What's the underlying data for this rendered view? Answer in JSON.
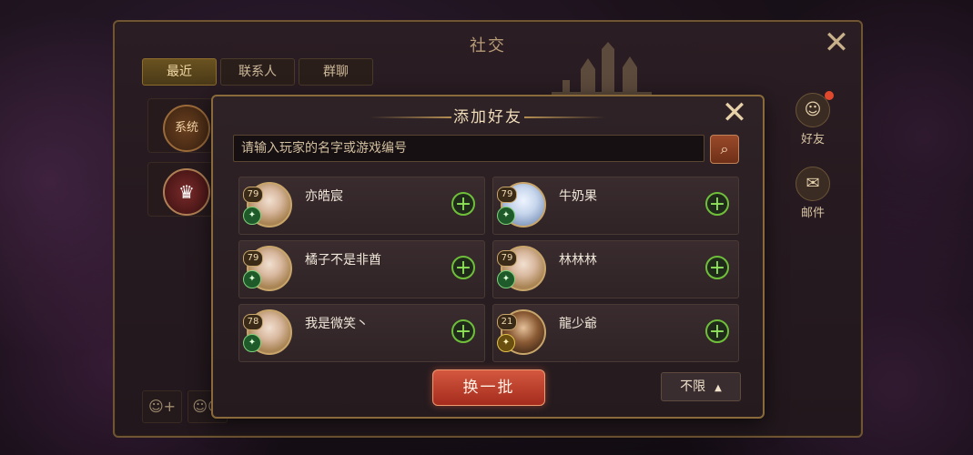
{
  "social_panel": {
    "title": "社交",
    "tabs": [
      {
        "label": "最近",
        "active": true
      },
      {
        "label": "联系人",
        "active": false
      },
      {
        "label": "群聊",
        "active": false
      }
    ],
    "recent": [
      {
        "label": "系统"
      }
    ],
    "side_nav": [
      {
        "label": "好友",
        "icon": "friends-icon",
        "dot": true
      },
      {
        "label": "邮件",
        "icon": "mail-icon",
        "dot": false
      }
    ]
  },
  "modal": {
    "title": "添加好友",
    "search_placeholder": "请输入玩家的名字或游戏编号",
    "friends": [
      {
        "name": "亦皓宸",
        "level": "79",
        "avatar": "gold",
        "badge": "green"
      },
      {
        "name": "牛奶果",
        "level": "79",
        "avatar": "silver",
        "badge": "green"
      },
      {
        "name": "橘子不是非酋",
        "level": "79",
        "avatar": "gold",
        "badge": "green"
      },
      {
        "name": "林林林",
        "level": "79",
        "avatar": "gold",
        "badge": "green"
      },
      {
        "name": "我是微笑丶",
        "level": "78",
        "avatar": "gold",
        "badge": "green"
      },
      {
        "name": "龍少爺",
        "level": "21",
        "avatar": "brown",
        "badge": "gold"
      }
    ],
    "refresh_label": "换一批",
    "filter_label": "不限"
  },
  "colors": {
    "accent_gold": "#c8a56a",
    "add_green": "#6fbf3a",
    "refresh_red": "#c7442f"
  }
}
